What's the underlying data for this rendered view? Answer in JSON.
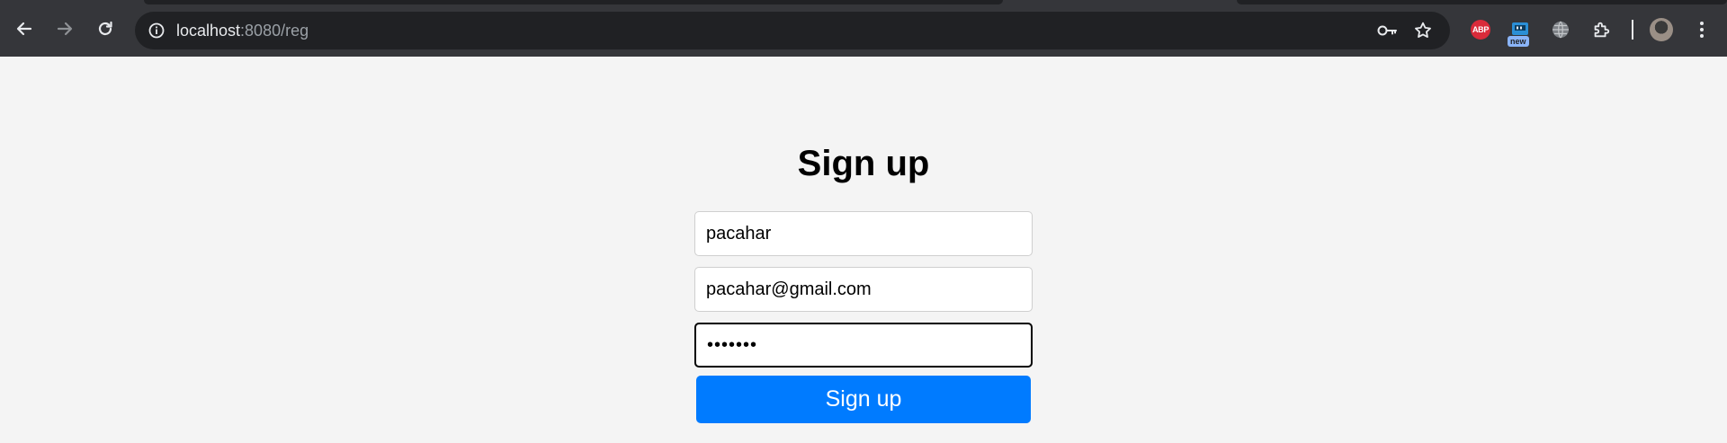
{
  "browser": {
    "url_host": "localhost",
    "url_rest": ":8080/reg",
    "extensions": {
      "abp_label": "ABP",
      "new_badge_label": "new"
    },
    "colors": {
      "chrome_bg": "#35363a",
      "omnibox_bg": "#202124",
      "icon": "#e8eaed"
    },
    "icons": [
      "back-arrow-icon",
      "forward-arrow-icon",
      "reload-icon",
      "site-info-icon",
      "password-key-icon",
      "bookmark-star-icon",
      "adblock-plus-icon",
      "new-extension-icon",
      "globe-icon",
      "extensions-puzzle-icon",
      "profile-avatar-icon",
      "kebab-menu-icon"
    ]
  },
  "signup": {
    "title": "Sign up",
    "username_value": "pacahar",
    "email_value": "pacahar@gmail.com",
    "password_value": "•••••••",
    "submit_label": "Sign up",
    "colors": {
      "button": "#007bff",
      "page_bg": "#f4f4f4"
    }
  }
}
